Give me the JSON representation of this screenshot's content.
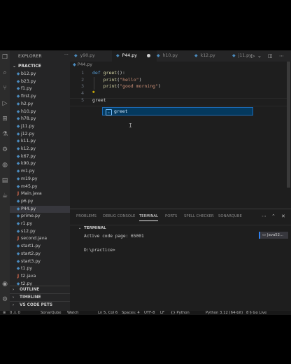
{
  "explorer": {
    "title": "EXPLORER",
    "more": "···",
    "folder": "PRACTICE",
    "files": [
      {
        "name": "b12.py",
        "type": "py"
      },
      {
        "name": "b23.py",
        "type": "py"
      },
      {
        "name": "f1.py",
        "type": "py"
      },
      {
        "name": "first.py",
        "type": "py"
      },
      {
        "name": "h2.py",
        "type": "py"
      },
      {
        "name": "h10.py",
        "type": "py"
      },
      {
        "name": "h78.py",
        "type": "py"
      },
      {
        "name": "j11.py",
        "type": "py"
      },
      {
        "name": "j12.py",
        "type": "py"
      },
      {
        "name": "k11.py",
        "type": "py"
      },
      {
        "name": "k12.py",
        "type": "py"
      },
      {
        "name": "k67.py",
        "type": "py"
      },
      {
        "name": "k90.py",
        "type": "py"
      },
      {
        "name": "m1.py",
        "type": "py"
      },
      {
        "name": "m19.py",
        "type": "py"
      },
      {
        "name": "m45.py",
        "type": "py"
      },
      {
        "name": "Main.java",
        "type": "java"
      },
      {
        "name": "p6.py",
        "type": "py"
      },
      {
        "name": "P44.py",
        "type": "py",
        "selected": true
      },
      {
        "name": "prime.py",
        "type": "py"
      },
      {
        "name": "r1.py",
        "type": "py"
      },
      {
        "name": "s12.py",
        "type": "py"
      },
      {
        "name": "second.java",
        "type": "java"
      },
      {
        "name": "start1.py",
        "type": "py"
      },
      {
        "name": "start2.py",
        "type": "py"
      },
      {
        "name": "start3.py",
        "type": "py"
      },
      {
        "name": "t1.py",
        "type": "py"
      },
      {
        "name": "t2.java",
        "type": "java"
      },
      {
        "name": "t2.py",
        "type": "py"
      }
    ],
    "sections": [
      "OUTLINE",
      "TIMELINE",
      "VS CODE PETS"
    ]
  },
  "tabs": [
    {
      "label": "y90.py",
      "active": false
    },
    {
      "label": "P44.py",
      "active": true,
      "modified": true
    },
    {
      "label": "h10.py",
      "active": false
    },
    {
      "label": "k12.py",
      "active": false
    },
    {
      "label": "j11.py",
      "active": false
    }
  ],
  "breadcrumb": "P44.py",
  "editor": {
    "lines": [
      {
        "num": "1",
        "tokens": [
          {
            "t": "def ",
            "c": "kw"
          },
          {
            "t": "greet",
            "c": "fn"
          },
          {
            "t": "():",
            "c": "pl"
          }
        ]
      },
      {
        "num": "2",
        "tokens": [
          {
            "t": "    print",
            "c": "fn"
          },
          {
            "t": "(",
            "c": "pl"
          },
          {
            "t": "\"hello\"",
            "c": "str"
          },
          {
            "t": ")",
            "c": "pl"
          }
        ]
      },
      {
        "num": "3",
        "tokens": [
          {
            "t": "    print",
            "c": "fn"
          },
          {
            "t": "(",
            "c": "pl"
          },
          {
            "t": "\"good morning\"",
            "c": "str"
          },
          {
            "t": ")",
            "c": "pl"
          }
        ]
      },
      {
        "num": "4",
        "tokens": []
      },
      {
        "num": "5",
        "tokens": [
          {
            "t": "greet",
            "c": "pl"
          }
        ]
      }
    ],
    "suggestion": "greet"
  },
  "panel": {
    "tabs": [
      "PROBLEMS",
      "DEBUG CONSOLE",
      "TERMINAL",
      "PORTS",
      "SPELL CHECKER",
      "SONARQUBE"
    ],
    "active_tab": "TERMINAL",
    "terminal_title": "TERMINAL",
    "terminal_lines": [
      "Active code page: 65001",
      "",
      "D:\\practice>"
    ],
    "java_button": "Java52..."
  },
  "status": {
    "items": [
      "0 ⚠ 0",
      "SonarQube",
      "Watch",
      "Ln 5, Col 6",
      "Spaces: 4",
      "UTF-8",
      "LF",
      "{} Python",
      "Python 3.12 (64-bit)",
      "8 § Go Live"
    ]
  },
  "colors": {
    "accent": "#2f80ed",
    "python": "#4b8bbe",
    "java": "#e76f51",
    "suggest_bg": "#04395e"
  }
}
